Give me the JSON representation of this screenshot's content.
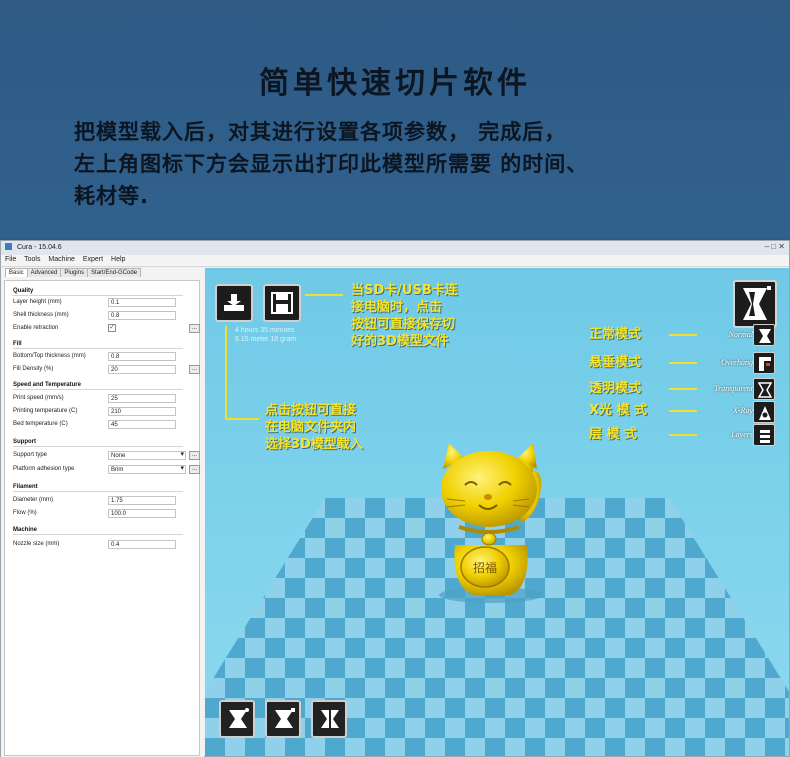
{
  "banner": {
    "title": "简单快速切片软件",
    "line1": "把模型载入后，对其进行设置各项参数，  完成后，",
    "line2": "左上角图标下方会显示出打印此模型所需要 的时间、",
    "line3": "耗材等."
  },
  "window": {
    "title": "Cura - 15.04.6",
    "controls": "–  □  ✕",
    "menu": [
      "File",
      "Tools",
      "Machine",
      "Expert",
      "Help"
    ],
    "tabs": [
      "Basic",
      "Advanced",
      "Plugins",
      "Start/End-GCode"
    ]
  },
  "settings": {
    "quality": {
      "header": "Quality",
      "layer_height_label": "Layer height (mm)",
      "layer_height": "0.1",
      "shell_thickness_label": "Shell thickness (mm)",
      "shell_thickness": "0.8",
      "retraction_label": "Enable retraction",
      "retraction_check": "✓",
      "more_btn": "..."
    },
    "fill": {
      "header": "Fill",
      "bottom_top_label": "Bottom/Top thickness (mm)",
      "bottom_top": "0.8",
      "density_label": "Fill Density (%)",
      "density": "20",
      "more_btn": "..."
    },
    "speed": {
      "header": "Speed and Temperature",
      "print_speed_label": "Print speed (mm/s)",
      "print_speed": "25",
      "printing_temp_label": "Printing temperature (C)",
      "printing_temp": "210",
      "bed_temp_label": "Bed temperature (C)",
      "bed_temp": "45"
    },
    "support": {
      "header": "Support",
      "support_type_label": "Support type",
      "support_type": "None",
      "adhesion_label": "Platform adhesion type",
      "adhesion": "Brim",
      "more_btn": "..."
    },
    "filament": {
      "header": "Filament",
      "diameter_label": "Diameter (mm)",
      "diameter": "1.75",
      "flow_label": "Flow (%)",
      "flow": "100.0"
    },
    "machine": {
      "header": "Machine",
      "nozzle_label": "Nozzle size (mm)",
      "nozzle": "0.4"
    }
  },
  "viewport": {
    "estimate_line1": "4 hours 35 minutes",
    "estimate_line2": "6.15 meter 18 gram",
    "annot_sd": [
      "当SD卡/USB卡连",
      "接电脑时，点击",
      "按钮可直接保存切",
      "好的3D模型文件"
    ],
    "annot_load": [
      "点击按钮可直接",
      "在电脑文件夹内",
      "选择3D模型载入"
    ],
    "modes": [
      {
        "cn": "正常模式",
        "en": "Normal"
      },
      {
        "cn": "悬垂模式",
        "en": "Overhang"
      },
      {
        "cn": "透明模式",
        "en": "Transparent"
      },
      {
        "cn": "X光 模 式",
        "en": "X-Ray"
      },
      {
        "cn": "层 模 式",
        "en": "Layers"
      }
    ],
    "coin_text": "招福"
  },
  "colors": {
    "banner_bg": "#2f5c86",
    "annotation": "#f6e32a",
    "model": "#e8c800",
    "viewport_sky": "#7fd3ec",
    "floor_a": "#4fa9cf",
    "floor_b": "#8fd0ea"
  }
}
